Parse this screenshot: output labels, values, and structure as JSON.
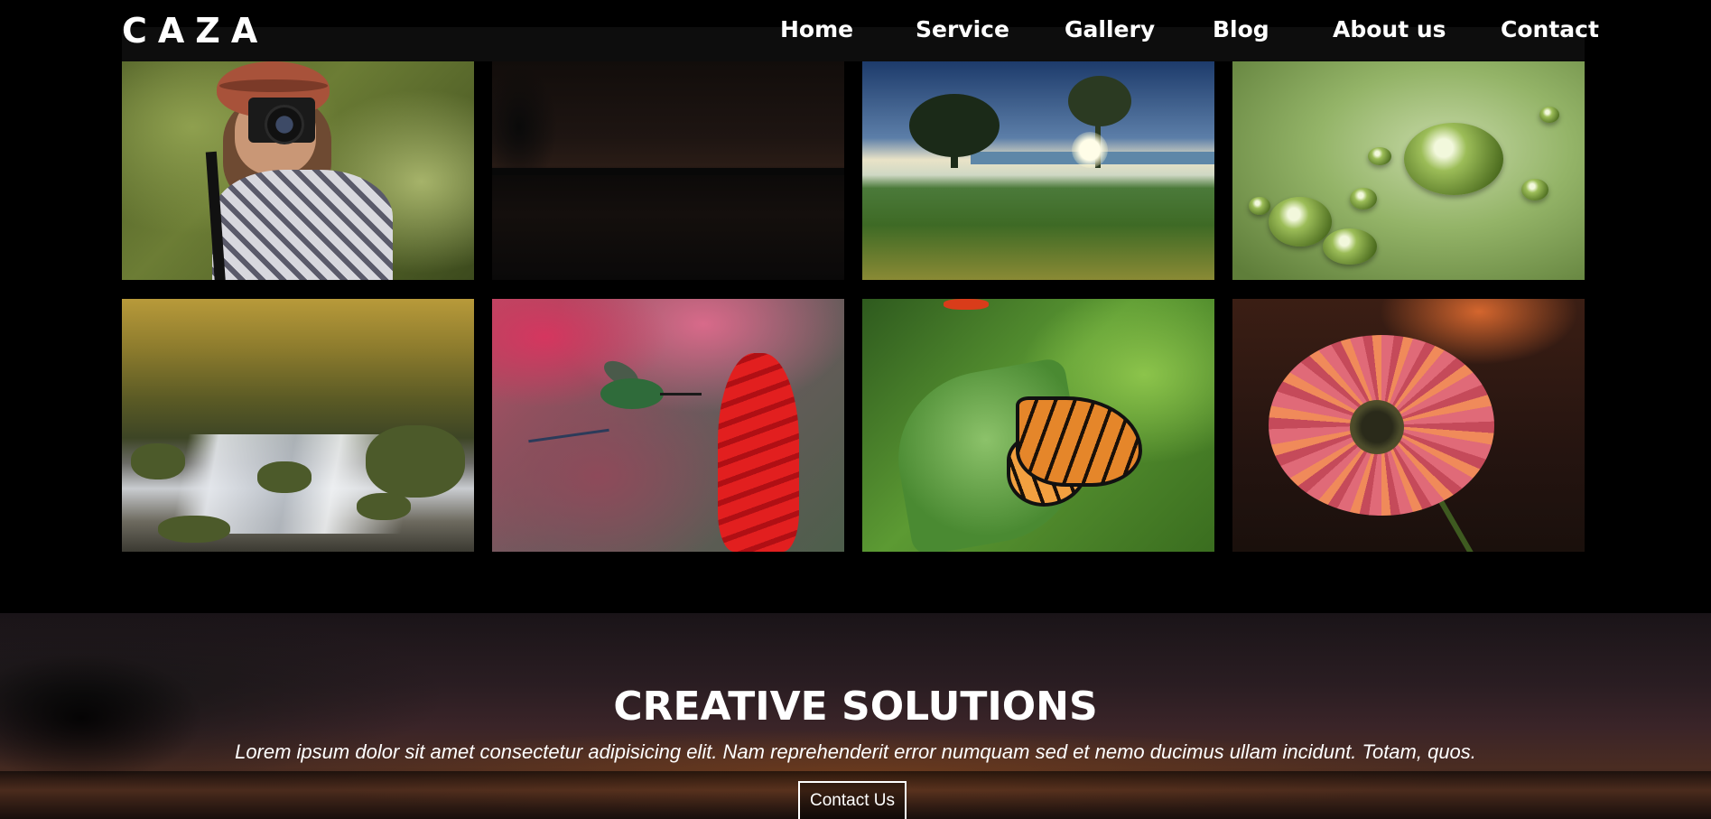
{
  "header": {
    "logo": "CAZA",
    "nav": [
      "Home",
      "Service",
      "Gallery",
      "Blog",
      "About us",
      "Contact"
    ]
  },
  "gallery": {
    "images": [
      {
        "name": "photographer-image"
      },
      {
        "name": "dark-lake-image"
      },
      {
        "name": "sunset-tree-field-image"
      },
      {
        "name": "water-drops-leaf-image"
      },
      {
        "name": "forest-stream-image"
      },
      {
        "name": "hummingbird-flower-image"
      },
      {
        "name": "monarch-butterfly-image"
      },
      {
        "name": "pink-daisy-image"
      }
    ]
  },
  "hero": {
    "title": "CREATIVE SOLUTIONS",
    "text": "Lorem ipsum dolor sit amet consectetur adipisicing elit. Nam reprehenderit error numquam sed et nemo ducimus ullam incidunt. Totam, quos.",
    "button_label": "Contact Us"
  }
}
